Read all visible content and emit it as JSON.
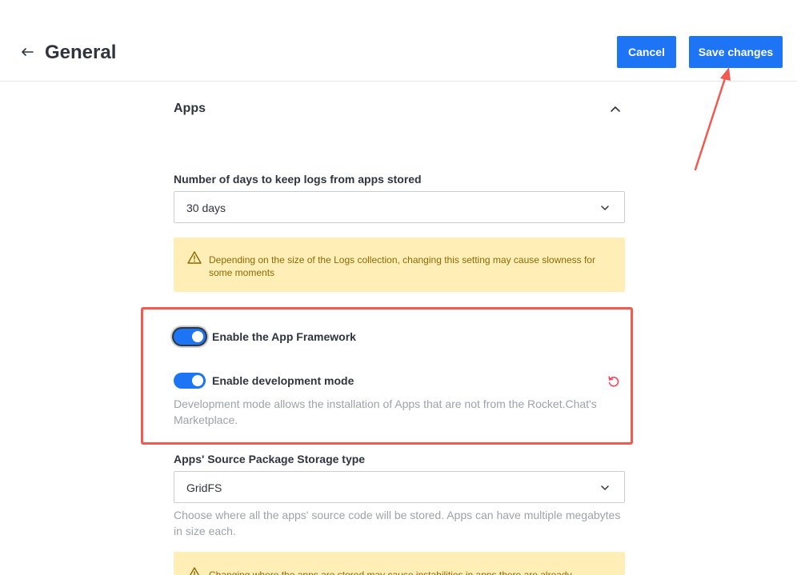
{
  "header": {
    "back_icon": "arrow-left-icon",
    "title": "General",
    "cancel_label": "Cancel",
    "save_label": "Save changes"
  },
  "section": {
    "title": "Apps",
    "collapse_icon": "chevron-up-icon"
  },
  "logs_field": {
    "label": "Number of days to keep logs from apps stored",
    "value": "30 days"
  },
  "logs_warning": {
    "icon": "warning-icon",
    "text": "Depending on the size of the Logs collection, changing this setting may cause slowness for some moments"
  },
  "framework_toggle": {
    "label": "Enable the App Framework",
    "on": true
  },
  "dev_mode_toggle": {
    "label": "Enable development mode",
    "on": true,
    "reset_icon": "reset-icon",
    "hint": "Development mode allows the installation of Apps that are not from the Rocket.Chat's Marketplace."
  },
  "storage_field": {
    "label": "Apps' Source Package Storage type",
    "value": "GridFS",
    "hint": "Choose where all the apps' source code will be stored. Apps can have multiple megabytes in size each."
  },
  "storage_warning": {
    "icon": "warning-icon",
    "text": "Changing where the apps are stored may cause instabilities in apps there are already"
  },
  "colors": {
    "primary": "#1d74f5",
    "annotation": "#f05a50",
    "warning_bg": "#ffeeb5"
  }
}
